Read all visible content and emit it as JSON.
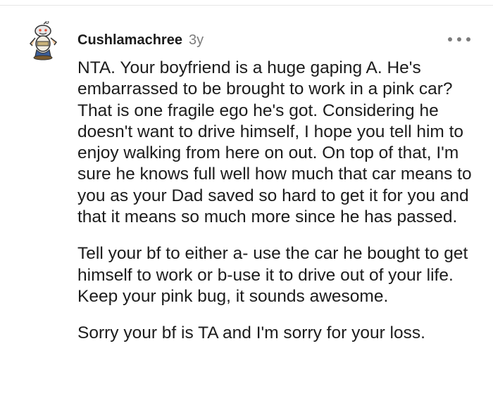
{
  "comment": {
    "username": "Cushlamachree",
    "age": "3y",
    "avatar_icon": "snoo-avatar-icon",
    "menu_icon": "more-options-icon",
    "paragraphs": [
      "NTA. Your boyfriend is a huge gaping A. He's embarrassed to be brought to work in a pink car? That is one fragile ego he's got. Considering he doesn't want to drive himself, I hope you tell him to enjoy walking from here on out. On top of that, I'm sure he knows full well how much that car means to you as your Dad saved so hard to get it for you and that it means so much more since he has passed.",
      "Tell your bf to either a- use the car he bought to get himself to work or b-use it to drive out of your life. Keep your pink bug, it sounds awesome.",
      "Sorry your bf is TA and I'm sorry for your loss."
    ]
  },
  "colors": {
    "text": "#1c1c1c",
    "meta": "#7c7c7c",
    "divider": "#e6e6e6"
  }
}
